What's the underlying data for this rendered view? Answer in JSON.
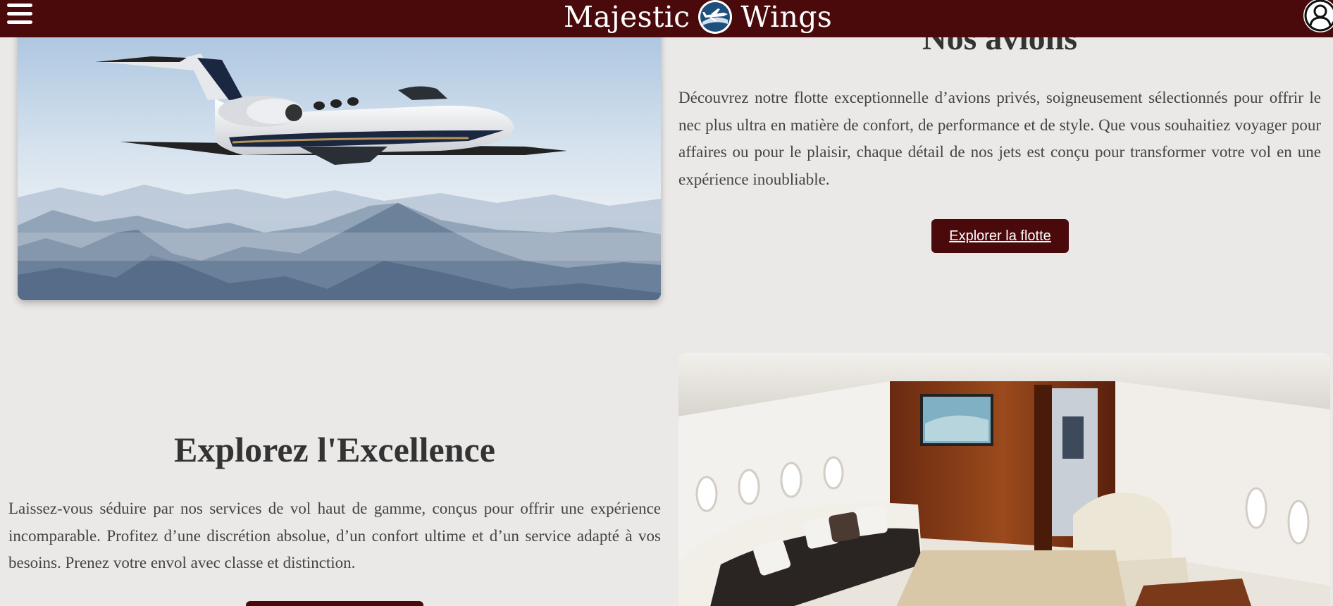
{
  "header": {
    "brand_left": "Majestic",
    "brand_right": "Wings",
    "menu_icon": "hamburger-menu-icon",
    "logo_icon": "plane-logo-icon",
    "user_icon": "user-account-icon"
  },
  "fleet_section": {
    "title": "Nos avions",
    "text": "Découvrez notre flotte exceptionnelle d’avions privés, soigneusement sélectionnés pour offrir le nec plus ultra en matière de confort, de performance et de style. Que vous souhaitiez voyager pour affaires ou pour le plaisir, chaque détail de nos jets est conçu pour transformer votre vol en une expérience inoubliable.",
    "button_label": "Explorer la flotte"
  },
  "excellence_section": {
    "title": "Explorez l'Excellence",
    "text": "Laissez-vous séduire par nos services de vol haut de gamme, conçus pour offrir une expérience incomparable. Profitez d’une discrétion absolue, d’un confort ultime et d’un service adapté à vos besoins. Prenez votre envol avec classe et distinction."
  },
  "colors": {
    "primary": "#4a0a0c",
    "background": "#ebe9e7",
    "text": "#3a3a3a"
  }
}
